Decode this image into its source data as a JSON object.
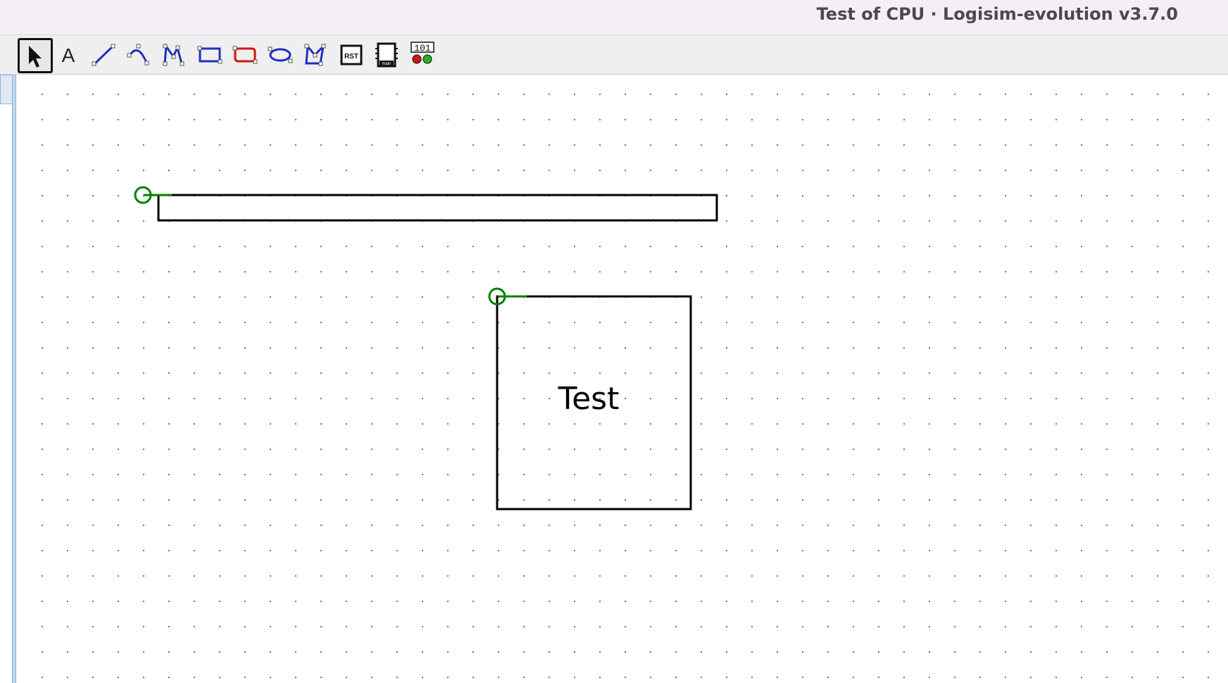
{
  "window": {
    "title": "Test of CPU · Logisim-evolution v3.7.0"
  },
  "toolbar": {
    "tools": [
      {
        "name": "select-tool",
        "icon": "arrow-pointer-icon",
        "selected": true
      },
      {
        "name": "text-tool",
        "icon": "text-A-icon",
        "label": "A"
      },
      {
        "name": "line-tool",
        "icon": "line-icon"
      },
      {
        "name": "curve-tool",
        "icon": "curve-icon"
      },
      {
        "name": "polyline-tool",
        "icon": "polyline-icon"
      },
      {
        "name": "rectangle-tool",
        "icon": "rectangle-icon"
      },
      {
        "name": "rounded-rectangle-tool",
        "icon": "rounded-rectangle-icon"
      },
      {
        "name": "ellipse-tool",
        "icon": "ellipse-icon"
      },
      {
        "name": "polygon-tool",
        "icon": "polygon-icon"
      },
      {
        "name": "reset-tool",
        "icon": "rst-icon",
        "label": "RST"
      },
      {
        "name": "main-circuit-tool",
        "icon": "chip-main-icon",
        "label": "main"
      },
      {
        "name": "led-display-tool",
        "icon": "binary-leds-icon",
        "label": "101"
      }
    ]
  },
  "canvas": {
    "grid": true,
    "shape_text": "Test",
    "colors": {
      "grid_dot": "#707070",
      "outline": "#000000",
      "anchor": "#008000",
      "tool_blue": "#1f2fbf",
      "tool_red": "#d21414"
    }
  }
}
